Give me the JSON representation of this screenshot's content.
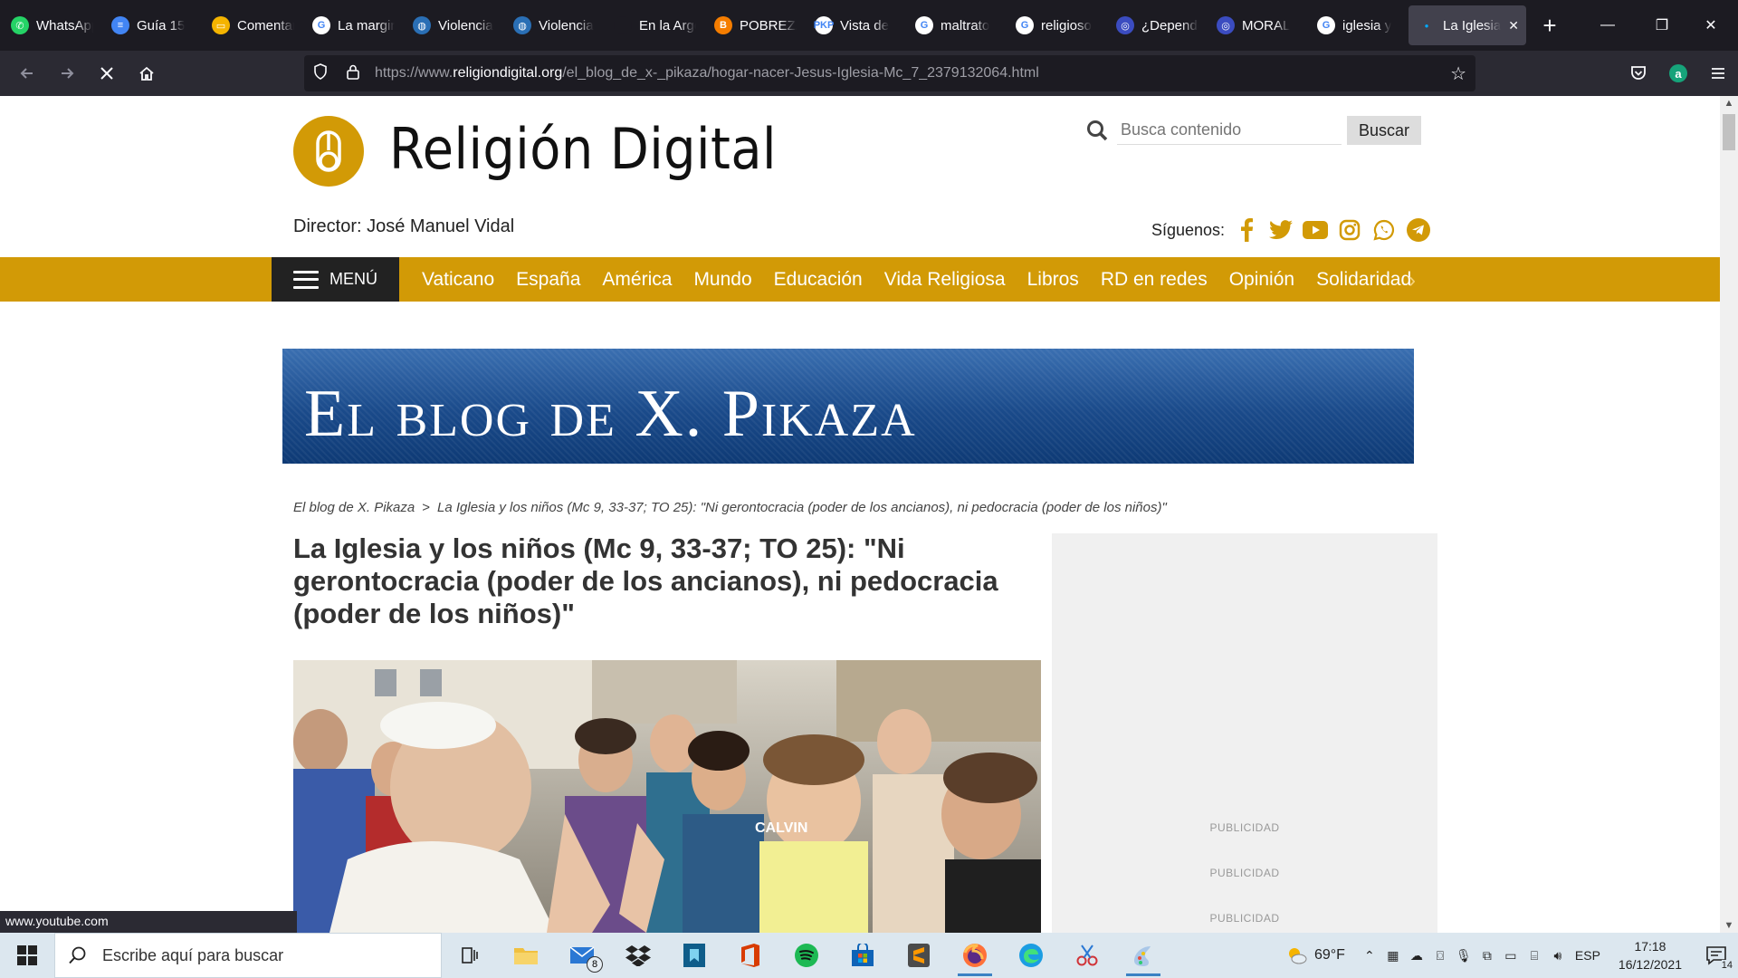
{
  "browser": {
    "tabs": [
      {
        "label": "WhatsApp",
        "color": "#25d366",
        "glyph": "✆"
      },
      {
        "label": "Guía 15",
        "color": "#4285f4",
        "glyph": "≡"
      },
      {
        "label": "Comentario",
        "color": "#f4b400",
        "glyph": "▭"
      },
      {
        "label": "La marginación",
        "color": "#ffffff",
        "glyph": "G"
      },
      {
        "label": "Violencia",
        "color": "#2a6fb5",
        "glyph": "◍"
      },
      {
        "label": "Violencia",
        "color": "#2a6fb5",
        "glyph": "◍"
      },
      {
        "label": "En la Argentina",
        "color": "#1c1b22",
        "glyph": ""
      },
      {
        "label": "POBREZA",
        "color": "#f57d00",
        "glyph": "B"
      },
      {
        "label": "Vista de",
        "color": "#ffffff",
        "glyph": "PKP"
      },
      {
        "label": "maltrato",
        "color": "#ffffff",
        "glyph": "G"
      },
      {
        "label": "religioso",
        "color": "#ffffff",
        "glyph": "G"
      },
      {
        "label": "¿Dependencia",
        "color": "#3b4cc0",
        "glyph": "◎"
      },
      {
        "label": "MORAL",
        "color": "#3b4cc0",
        "glyph": "◎"
      },
      {
        "label": "iglesia y",
        "color": "#ffffff",
        "glyph": "G"
      }
    ],
    "active_tab": {
      "label": "La Iglesia",
      "close": "✕"
    },
    "new_tab": "+",
    "window": {
      "minimize": "—",
      "restore": "❐",
      "close": "✕"
    },
    "url": {
      "prefix": "https://www.",
      "host": "religiondigital.org",
      "path": "/el_blog_de_x-_pikaza/hogar-nacer-Jesus-Iglesia-Mc_7_2379132064.html"
    },
    "status_link": "www.youtube.com"
  },
  "site": {
    "brand_color": "#d29a06",
    "title": "Religión Digital",
    "search_placeholder": "Busca contenido",
    "search_button": "Buscar",
    "director": "Director: José Manuel Vidal",
    "follow_label": "Síguenos:",
    "social": [
      "facebook-icon",
      "twitter-icon",
      "youtube-icon",
      "instagram-icon",
      "whatsapp-icon",
      "telegram-icon"
    ],
    "menu_label": "MENÚ",
    "menu_items": [
      "Vaticano",
      "España",
      "América",
      "Mundo",
      "Educación",
      "Vida Religiosa",
      "Libros",
      "RD en redes",
      "Opinión",
      "Solidaridad"
    ]
  },
  "blog": {
    "banner_title": "El blog de X. Pikaza",
    "breadcrumb": [
      "El blog de X. Pikaza",
      "La Iglesia y los niños (Mc 9, 33-37; TO 25): \"Ni gerontocracia (poder de los ancianos), ni pedocracia (poder de los niños)\""
    ],
    "breadcrumb_sep": ">",
    "article_title": "La Iglesia y los niños (Mc 9, 33-37; TO 25): \"Ni gerontocracia (poder de los ancianos), ni pedocracia (poder de los niños)\"",
    "photo_shirt_text": "CALVIN"
  },
  "sidebar": {
    "ad_labels": [
      "PUBLICIDAD",
      "PUBLICIDAD",
      "PUBLICIDAD"
    ]
  },
  "taskbar": {
    "search_placeholder": "Escribe aquí para buscar",
    "mail_badge": "8",
    "weather": "69°F",
    "language": "ESP",
    "time": "17:18",
    "date": "16/12/2021",
    "notifications": "14"
  }
}
